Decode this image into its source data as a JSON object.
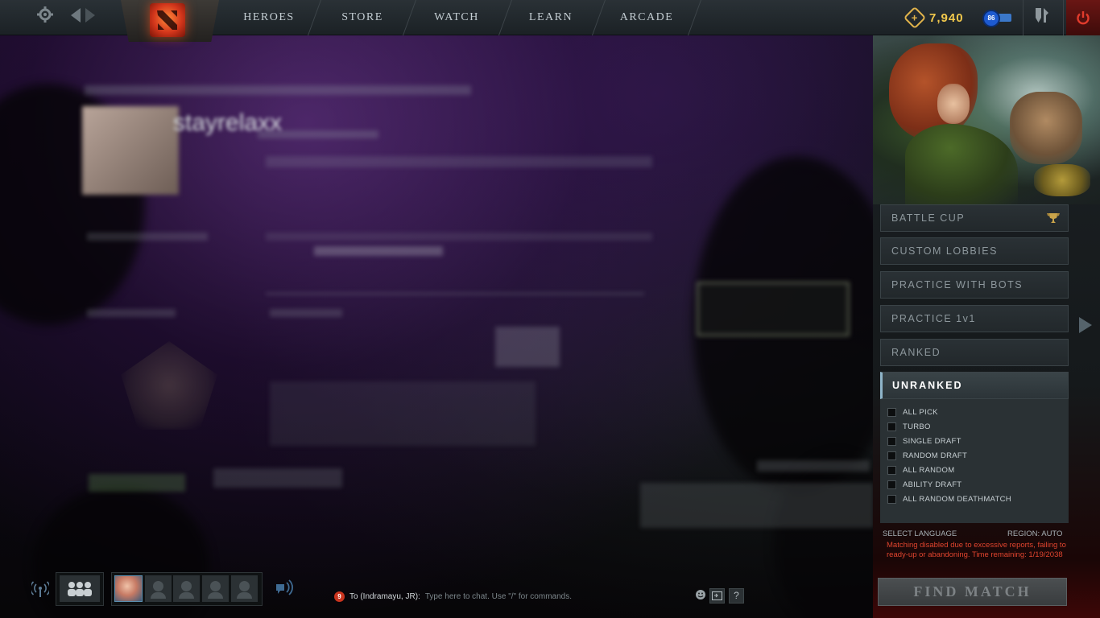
{
  "topbar": {
    "nav": [
      "HEROES",
      "STORE",
      "WATCH",
      "LEARN",
      "ARCADE"
    ],
    "gold": "7,940",
    "level": "86",
    "icons": {
      "settings": "gear-icon",
      "back": "arrow-left-icon",
      "forward": "arrow-right-icon",
      "logo": "dota-logo-icon",
      "armory": "armory-icon",
      "power": "power-icon"
    }
  },
  "background": {
    "player_name": "stayrelaxx"
  },
  "play_panel": {
    "modes": [
      "BATTLE CUP",
      "CUSTOM LOBBIES",
      "PRACTICE WITH BOTS",
      "PRACTICE 1v1",
      "RANKED",
      "UNRANKED"
    ],
    "active_mode": "UNRANKED",
    "unranked_options": [
      "ALL PICK",
      "TURBO",
      "SINGLE DRAFT",
      "RANDOM DRAFT",
      "ALL RANDOM",
      "ABILITY DRAFT",
      "ALL RANDOM DEATHMATCH"
    ],
    "select_language": "SELECT LANGUAGE",
    "region": "REGION: AUTO",
    "warning": "Matching disabled due to excessive reports, failing to ready-up or abandoning. Time remaining: 1/19/2038",
    "find_match": "FIND MATCH",
    "colors": {
      "warning": "#e0442e",
      "gold": "#f2c94c",
      "active_accent": "#8fb5c9"
    }
  },
  "bottombar": {
    "unread_count": "9",
    "chat_target": "To (Indramayu, JR):",
    "chat_placeholder": "Type here to chat. Use \"/\" for commands.",
    "help_label": "?"
  }
}
